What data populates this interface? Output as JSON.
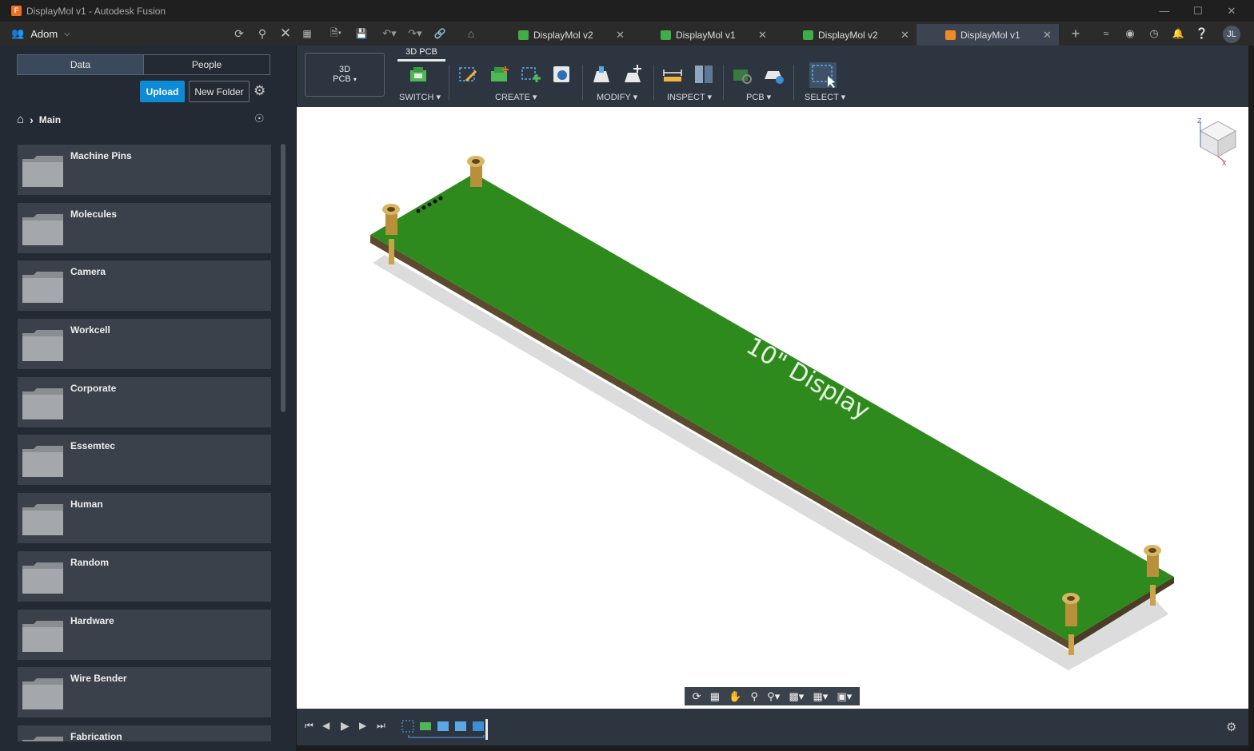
{
  "window": {
    "title": "DisplayMol v1 - Autodesk Fusion",
    "app_icon_letter": "F"
  },
  "appbar": {
    "user_name": "Adom",
    "avatar_initials": "JL",
    "tabs": [
      {
        "label": "DisplayMol v2",
        "icon_color": "#3fae49",
        "active": false
      },
      {
        "label": "DisplayMol v1",
        "icon_color": "#3fae49",
        "active": false
      },
      {
        "label": "DisplayMol v2",
        "icon_color": "#3fae49",
        "active": false
      },
      {
        "label": "DisplayMol v1",
        "icon_color": "#f08a24",
        "active": true
      }
    ]
  },
  "data_panel": {
    "segments": [
      "Data",
      "People"
    ],
    "active_segment": "Data",
    "upload_label": "Upload",
    "new_folder_label": "New Folder",
    "breadcrumb": "Main",
    "folders": [
      "Machine Pins",
      "Molecules",
      "Camera",
      "Workcell",
      "Corporate",
      "Essemtec",
      "Human",
      "Random",
      "Hardware",
      "Wire Bender",
      "Fabrication"
    ]
  },
  "toolbar": {
    "workspace_line1": "3D",
    "workspace_line2": "PCB",
    "workspace_tab": "3D PCB",
    "groups": [
      "SWITCH",
      "CREATE",
      "MODIFY",
      "INSPECT",
      "PCB",
      "SELECT"
    ]
  },
  "viewport": {
    "board_text": "10\" Display",
    "board_color": "#2f8a1e",
    "viewcube_axes": [
      "Z",
      "X"
    ]
  },
  "colors": {
    "accent": "#0c8bd6",
    "panel": "#242a33",
    "toolbar": "#2d3540"
  }
}
